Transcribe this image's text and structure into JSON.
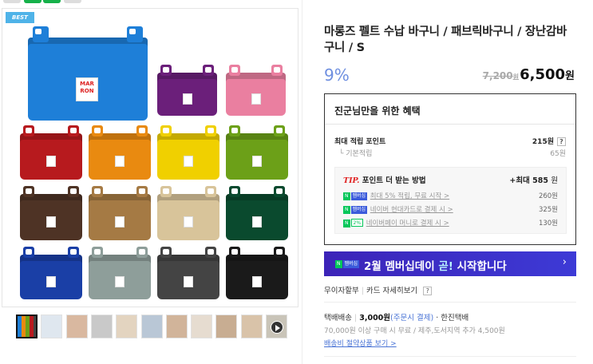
{
  "gallery": {
    "badge": "BEST",
    "brand_tag": [
      "MAR",
      "RON"
    ],
    "basket_colors": [
      "#1e7fd8",
      "#6b1f7a",
      "#ea7fa0",
      "#b71a1e",
      "#e98a10",
      "#f0d000",
      "#6ca018",
      "#4e3325",
      "#a57a44",
      "#d8c49a",
      "#0a4a2e",
      "#1a3fa6",
      "#8e9e9a",
      "#444444",
      "#1a1a1a"
    ],
    "thumb_colors": [
      "#dfe7ef",
      "#d9b8a0",
      "#c9c9c9",
      "#e3d4c0",
      "#b9c7d6",
      "#d1b49a",
      "#e6dcd0",
      "#c8ad92",
      "#d9c3a9",
      "#c5c0b6"
    ]
  },
  "product": {
    "title": "마롱즈 펠트 수납 바구니 / 패브릭바구니 / 장난감바구니 / S",
    "discount": "9%",
    "original_price": "7,200",
    "original_unit": "원",
    "sale_price": "6,500",
    "sale_unit": "원"
  },
  "benefit": {
    "header": "진군님만을 위한 혜택",
    "max_points_label": "최대 적립 포인트",
    "max_points_value": "215원",
    "basic_label": "기본적립",
    "basic_value": "65원",
    "tip_word": "TIP.",
    "tip_title": "포인트 더 받는 방법",
    "tip_max": "+최대 585",
    "tip_max_unit": "원",
    "lines": [
      {
        "badge": "멤버십",
        "text": "최대 5% 적립, 무료 시작 >",
        "amount": "260원"
      },
      {
        "badge": "멤버십",
        "text": "네이버 현대카드로 결제 시 >",
        "amount": "325원"
      },
      {
        "badge": "2%",
        "text": "네이버페이 머니로 결제 시 >",
        "amount": "130원"
      }
    ]
  },
  "banner": {
    "badge": "멤버십",
    "text_prefix": "2월 멤버십데이 ",
    "text_highlight": "곧!",
    "text_suffix": " 시작합니다",
    "arrow": "›"
  },
  "installment": {
    "label1": "무이자할부",
    "label2": "카드 자세히보기"
  },
  "shipping": {
    "type": "택배배송",
    "fee": "3,000원",
    "fee_note": "(주문시 결제)",
    "carrier": "· 한진택배",
    "free_note": "70,000원 이상 구매 시 무료 / 제주,도서지역 추가 4,500원",
    "saving_link": "배송비 절약상품 보기 >"
  },
  "colors": {
    "accent_blue": "#6e8fe0",
    "naver_green": "#03c75a",
    "membership_blue": "#3b5bdb"
  }
}
